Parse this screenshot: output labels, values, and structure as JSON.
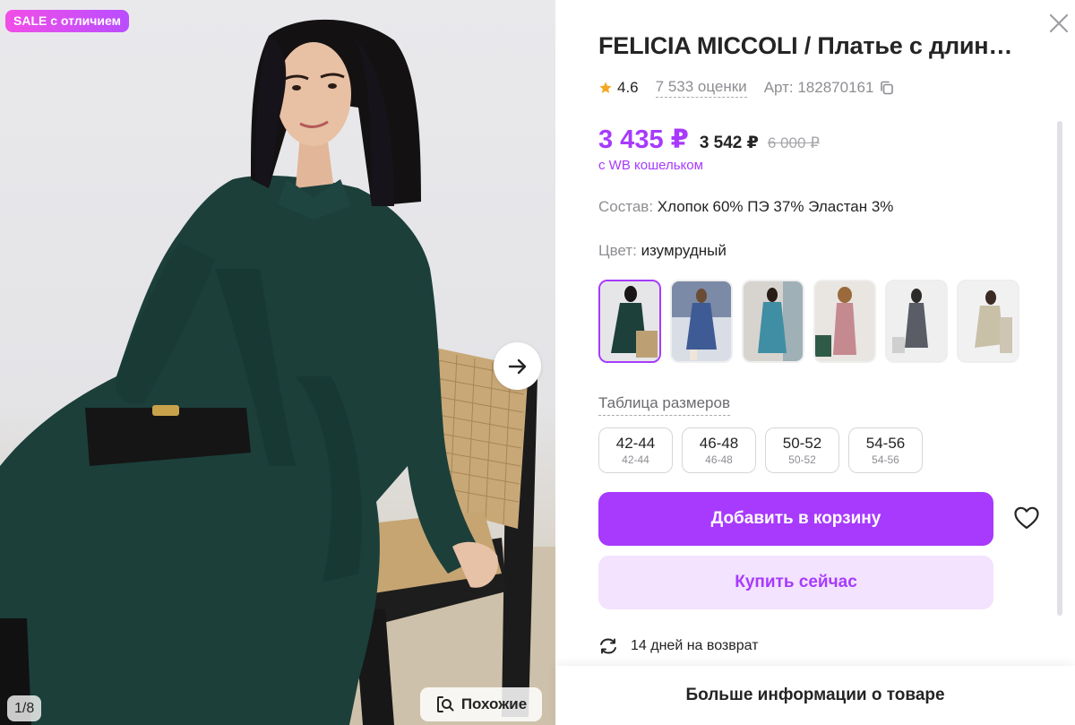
{
  "gallery": {
    "badge": "SALE с отличием",
    "counter": "1/8",
    "similar_label": "Похожие",
    "icons": {
      "next": "arrow-right-icon",
      "similar": "search-similar-icon"
    }
  },
  "product": {
    "title": "FELICIA MICCOLI / Платье с длин…",
    "rating": "4.6",
    "reviews": "7 533 оценки",
    "article": "Арт: 182870161",
    "price_main": "3 435 ₽",
    "price_card": "3 542 ₽",
    "price_old": "6 000 ₽",
    "wallet_note": "с WB кошельком",
    "composition_label": "Состав:",
    "composition_value": "Хлопок 60% ПЭ 37% Эластан 3%",
    "color_label": "Цвет:",
    "color_value": "изумрудный",
    "size_table_label": "Таблица размеров",
    "sizes": [
      {
        "main": "42-44",
        "sub": "42-44"
      },
      {
        "main": "46-48",
        "sub": "46-48"
      },
      {
        "main": "50-52",
        "sub": "50-52"
      },
      {
        "main": "54-56",
        "sub": "54-56"
      }
    ],
    "add_to_cart": "Добавить в корзину",
    "buy_now": "Купить сейчас",
    "returns": "14 дней на возврат",
    "more_info": "Больше информации о товаре"
  },
  "colors": {
    "accent": "#a73afd",
    "accent_light": "#f3e3fe",
    "badge_from": "#f14ee6",
    "badge_to": "#b94dff",
    "star": "#f6a623"
  },
  "icons": {
    "close": "close-icon",
    "star": "star-icon",
    "copy": "copy-icon",
    "favorite": "heart-icon",
    "returns": "refresh-icon"
  }
}
